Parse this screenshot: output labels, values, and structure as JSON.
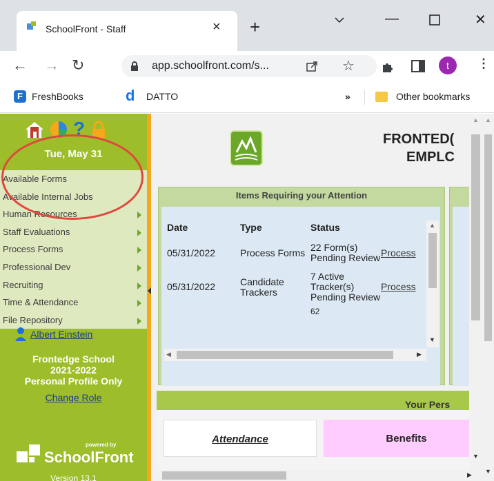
{
  "browser": {
    "tab_title": "SchoolFront - Staff",
    "url": "app.schoolfront.com/s...",
    "profile_initial": "t",
    "bookmarks": [
      "FreshBooks",
      "DATTO"
    ],
    "bookmarks_more": "»",
    "other_bookmarks": "Other bookmarks"
  },
  "sidebar": {
    "date": "Tue, May 31",
    "menu": [
      {
        "label": "Available Forms",
        "arrow": false
      },
      {
        "label": "Available Internal Jobs",
        "arrow": false
      },
      {
        "label": "Human Resources",
        "arrow": true
      },
      {
        "label": "Staff Evaluations",
        "arrow": true
      },
      {
        "label": "Process Forms",
        "arrow": true
      },
      {
        "label": "Professional Dev",
        "arrow": true
      },
      {
        "label": "Recruiting",
        "arrow": true
      },
      {
        "label": "Time & Attendance",
        "arrow": true
      },
      {
        "label": "File Repository",
        "arrow": true
      }
    ],
    "user_name": "Albert Einstein",
    "school": "Frontedge School",
    "year": "2021-2022",
    "profile": "Personal Profile Only",
    "change_role": "Change Role",
    "powered_by": "powered by",
    "brand": "SchoolFront",
    "version": "Version 13.1"
  },
  "main": {
    "header_line1": "FRONTED(",
    "header_line2": "EMPLC",
    "attention_title": "Items Requiring your Attention",
    "columns": [
      "Date",
      "Type",
      "Status"
    ],
    "rows": [
      {
        "date": "05/31/2022",
        "type": "Process Forms",
        "status": "22 Form(s) Pending Review",
        "action": "Process"
      },
      {
        "date": "05/31/2022",
        "type": "Candidate Trackers",
        "status": "7 Active Tracker(s) Pending Review",
        "action": "Process"
      }
    ],
    "partial_row": "62",
    "personal_title": "Your Pers",
    "tabs": [
      {
        "label": "Attendance",
        "color": "#ffffff"
      },
      {
        "label": "Benefits",
        "color": "#ffccff"
      }
    ]
  }
}
